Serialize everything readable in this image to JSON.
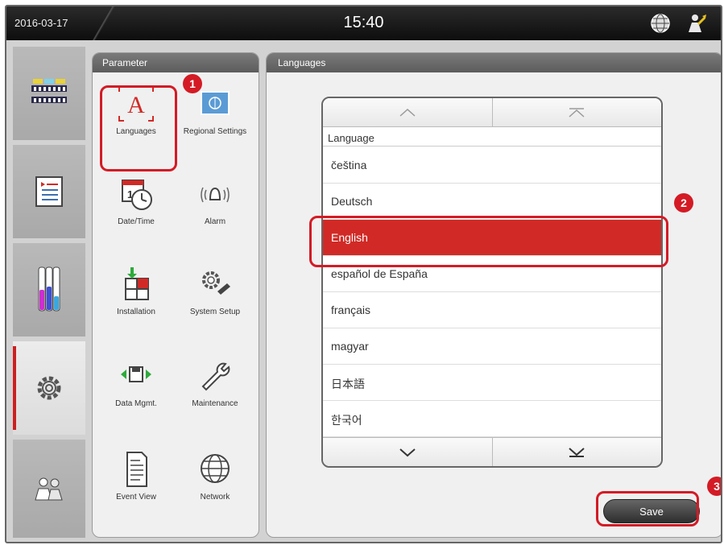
{
  "status_bar": {
    "date": "2016-03-17",
    "time": "15:40",
    "globe_icon": "globe-icon",
    "user_icon": "user-key-icon"
  },
  "left_nav": {
    "items": [
      {
        "icon": "sample-rack-icon",
        "active": false
      },
      {
        "icon": "program-list-icon",
        "active": false
      },
      {
        "icon": "reagent-vials-icon",
        "active": false
      },
      {
        "icon": "gear-icon",
        "active": true
      },
      {
        "icon": "user-access-icon",
        "active": false
      }
    ]
  },
  "parameter_panel": {
    "title": "Parameter",
    "items": [
      {
        "label": "Languages",
        "icon": "language-letter-icon"
      },
      {
        "label": "Regional Settings",
        "icon": "regional-flag-icon"
      },
      {
        "label": "Date/Time",
        "icon": "calendar-clock-icon"
      },
      {
        "label": "Alarm",
        "icon": "alarm-bell-icon"
      },
      {
        "label": "Installation",
        "icon": "installation-icon"
      },
      {
        "label": "System Setup",
        "icon": "system-setup-icon"
      },
      {
        "label": "Data Mgmt.",
        "icon": "data-management-icon"
      },
      {
        "label": "Maintenance",
        "icon": "wrench-icon"
      },
      {
        "label": "Event View",
        "icon": "event-document-icon"
      },
      {
        "label": "Network",
        "icon": "network-globe-icon"
      }
    ]
  },
  "languages_panel": {
    "title": "Languages",
    "list_header": "Language",
    "languages": [
      "čeština",
      "Deutsch",
      "English",
      "español de España",
      "français",
      "magyar",
      "日本語",
      "한국어"
    ],
    "selected": "English",
    "save_label": "Save"
  },
  "callouts": {
    "one": "1",
    "two": "2",
    "three": "3"
  },
  "colors": {
    "accent_red": "#d12a26",
    "header_dark": "#5c5c5c"
  }
}
